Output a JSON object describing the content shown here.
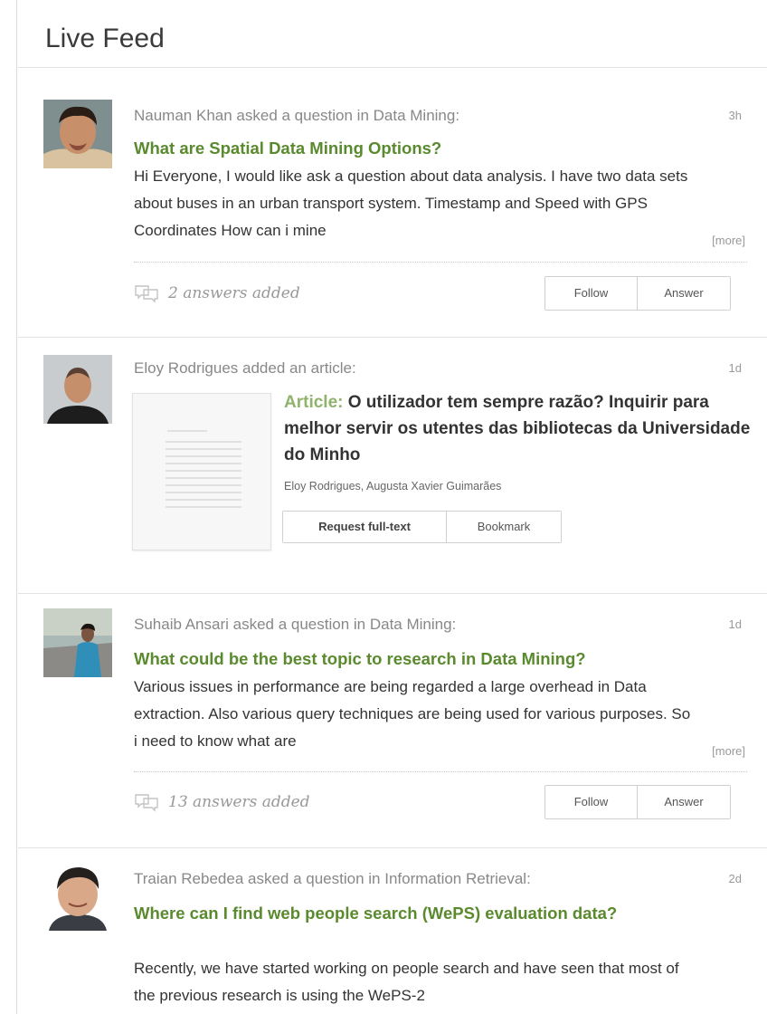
{
  "feed_title": "Live Feed",
  "colors": {
    "accent_green": "#5a8a2e",
    "article_label_green": "#8fb36a",
    "meta_gray": "#888888"
  },
  "items": [
    {
      "type": "question",
      "meta": "Nauman Khan asked a question in Data Mining:",
      "time": "3h",
      "title": "What are Spatial Data Mining Options?",
      "excerpt": "Hi Everyone, I would like ask a question about data analysis. I have two data sets about buses in an urban transport system. Timestamp and Speed with GPS Coordinates How can i mine",
      "more": "[more]",
      "answers": "2 answers added",
      "follow": "Follow",
      "answer": "Answer"
    },
    {
      "type": "article",
      "meta": "Eloy Rodrigues added an article:",
      "time": "1d",
      "label": "Article:",
      "title": "O utilizador tem sempre razão? Inquirir para melhor servir os utentes das bibliotecas da Universidade do Minho",
      "authors": "Eloy Rodrigues, Augusta Xavier Guimarães",
      "request": "Request full-text",
      "bookmark": "Bookmark"
    },
    {
      "type": "question",
      "meta": "Suhaib Ansari asked a question in Data Mining:",
      "time": "1d",
      "title": "What could be the best topic to research in Data Mining?",
      "excerpt": "Various issues in performance are being regarded a large overhead in Data extraction. Also various query techniques are being used for various purposes. So i need to know what are",
      "more": "[more]",
      "answers": "13 answers added",
      "follow": "Follow",
      "answer": "Answer"
    },
    {
      "type": "question",
      "meta": "Traian Rebedea asked a question in Information Retrieval:",
      "time": "2d",
      "title": "Where can I find web people search (WePS) evaluation data?",
      "excerpt": "Recently, we have started working on people search and have seen that most of the previous research is using the WePS-2"
    }
  ]
}
